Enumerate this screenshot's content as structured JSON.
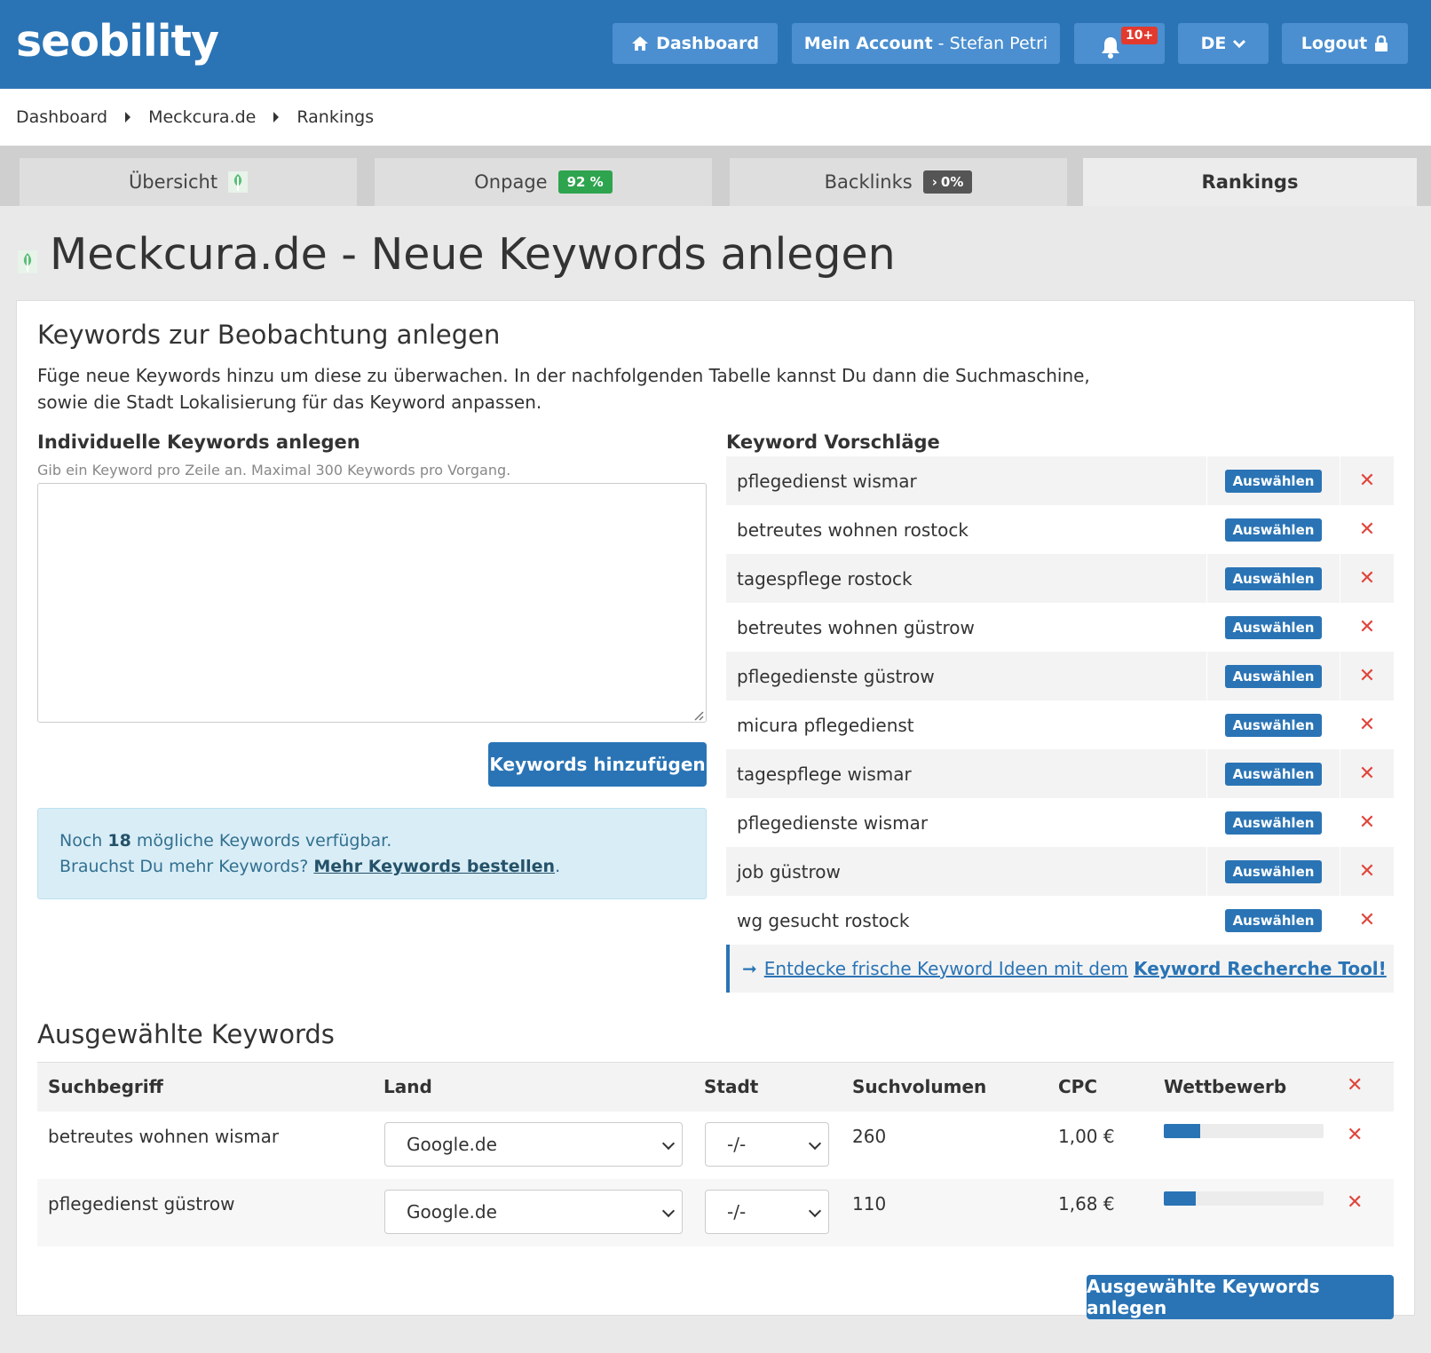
{
  "header": {
    "logo": "seobility",
    "dashboard_label": "Dashboard",
    "account_label": "Mein Account",
    "account_user": "- Stefan Petri",
    "notifications_badge": "10+",
    "language": "DE",
    "logout_label": "Logout"
  },
  "breadcrumb": [
    "Dashboard",
    "Meckcura.de",
    "Rankings"
  ],
  "tabs": {
    "overview": "Übersicht",
    "onpage": "Onpage",
    "onpage_badge": "92 %",
    "backlinks": "Backlinks",
    "backlinks_badge": "0%",
    "rankings": "Rankings"
  },
  "page_title": "Meckcura.de - Neue Keywords anlegen",
  "section": {
    "title": "Keywords zur Beobachtung anlegen",
    "description_line1": "Füge neue Keywords hinzu um diese zu überwachen. In der nachfolgenden Tabelle kannst Du dann die Suchmaschine,",
    "description_line2": "sowie die Stadt Lokalisierung für das Keyword anpassen."
  },
  "individual": {
    "title": "Individuelle Keywords anlegen",
    "hint": "Gib ein Keyword pro Zeile an. Maximal 300 Keywords pro Vorgang.",
    "textarea_value": "",
    "add_button": "Keywords hinzufügen"
  },
  "info": {
    "prefix": "Noch",
    "count": "18",
    "suffix": "mögliche Keywords verfügbar.",
    "line2_prefix": "Brauchst Du mehr Keywords?",
    "link": "Mehr Keywords bestellen",
    "line2_end": "."
  },
  "suggestions": {
    "title": "Keyword Vorschläge",
    "select_label": "Auswählen",
    "items": [
      "pflegedienst wismar",
      "betreutes wohnen rostock",
      "tagespflege rostock",
      "betreutes wohnen güstrow",
      "pflegedienste güstrow",
      "micura pflegedienst",
      "tagespflege wismar",
      "pflegedienste wismar",
      "job güstrow",
      "wg gesucht rostock"
    ],
    "recherche_prefix": "Entdecke frische Keyword Ideen mit dem",
    "recherche_link": "Keyword Recherche Tool!"
  },
  "selected": {
    "title": "Ausgewählte Keywords",
    "columns": [
      "Suchbegriff",
      "Land",
      "Stadt",
      "Suchvolumen",
      "CPC",
      "Wettbewerb"
    ],
    "rows": [
      {
        "keyword": "betreutes wohnen wismar",
        "land": "Google.de",
        "stadt": "-/-",
        "volume": "260",
        "cpc": "1,00 €",
        "competition": 0.23
      },
      {
        "keyword": "pflegedienst güstrow",
        "land": "Google.de",
        "stadt": "-/-",
        "volume": "110",
        "cpc": "1,68 €",
        "competition": 0.2
      }
    ],
    "submit_button": "Ausgewählte Keywords anlegen"
  },
  "colors": {
    "brand_blue": "#2a74b5",
    "success_green": "#2ea44f",
    "danger_red": "#e0463c"
  }
}
